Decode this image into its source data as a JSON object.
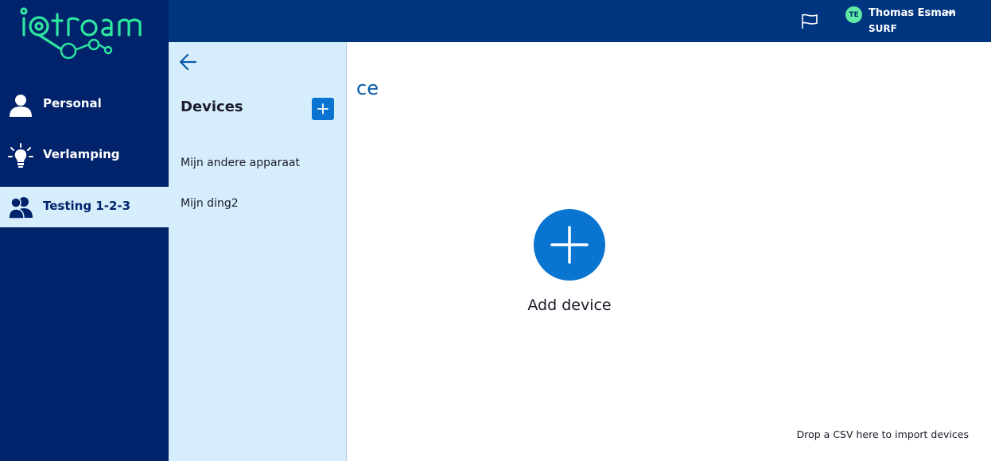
{
  "brand": {
    "logo_text": "iotroam"
  },
  "header": {
    "user": {
      "initials": "TE",
      "name": "Thomas Esman",
      "org": "SURF"
    }
  },
  "sidebar": {
    "items": [
      {
        "label": "Personal",
        "icon": "person-icon"
      },
      {
        "label": "Verlamping",
        "icon": "lightbulb-icon"
      },
      {
        "label": "Testing 1-2-3",
        "icon": "group-icon"
      }
    ],
    "active_index": 2
  },
  "devices_panel": {
    "title": "Devices",
    "items": [
      {
        "label": "Mijn andere apparaat"
      },
      {
        "label": "Mijn ding2"
      }
    ]
  },
  "main": {
    "title_fragment": "ce",
    "add_label": "Add device",
    "csv_hint": "Drop a CSV here to import devices"
  },
  "colors": {
    "header_bg": "#003580",
    "sidebar_bg": "#00236b",
    "panel_bg": "#d6eefb",
    "accent": "#0a74d1",
    "logo_green": "#2ee6a0"
  }
}
